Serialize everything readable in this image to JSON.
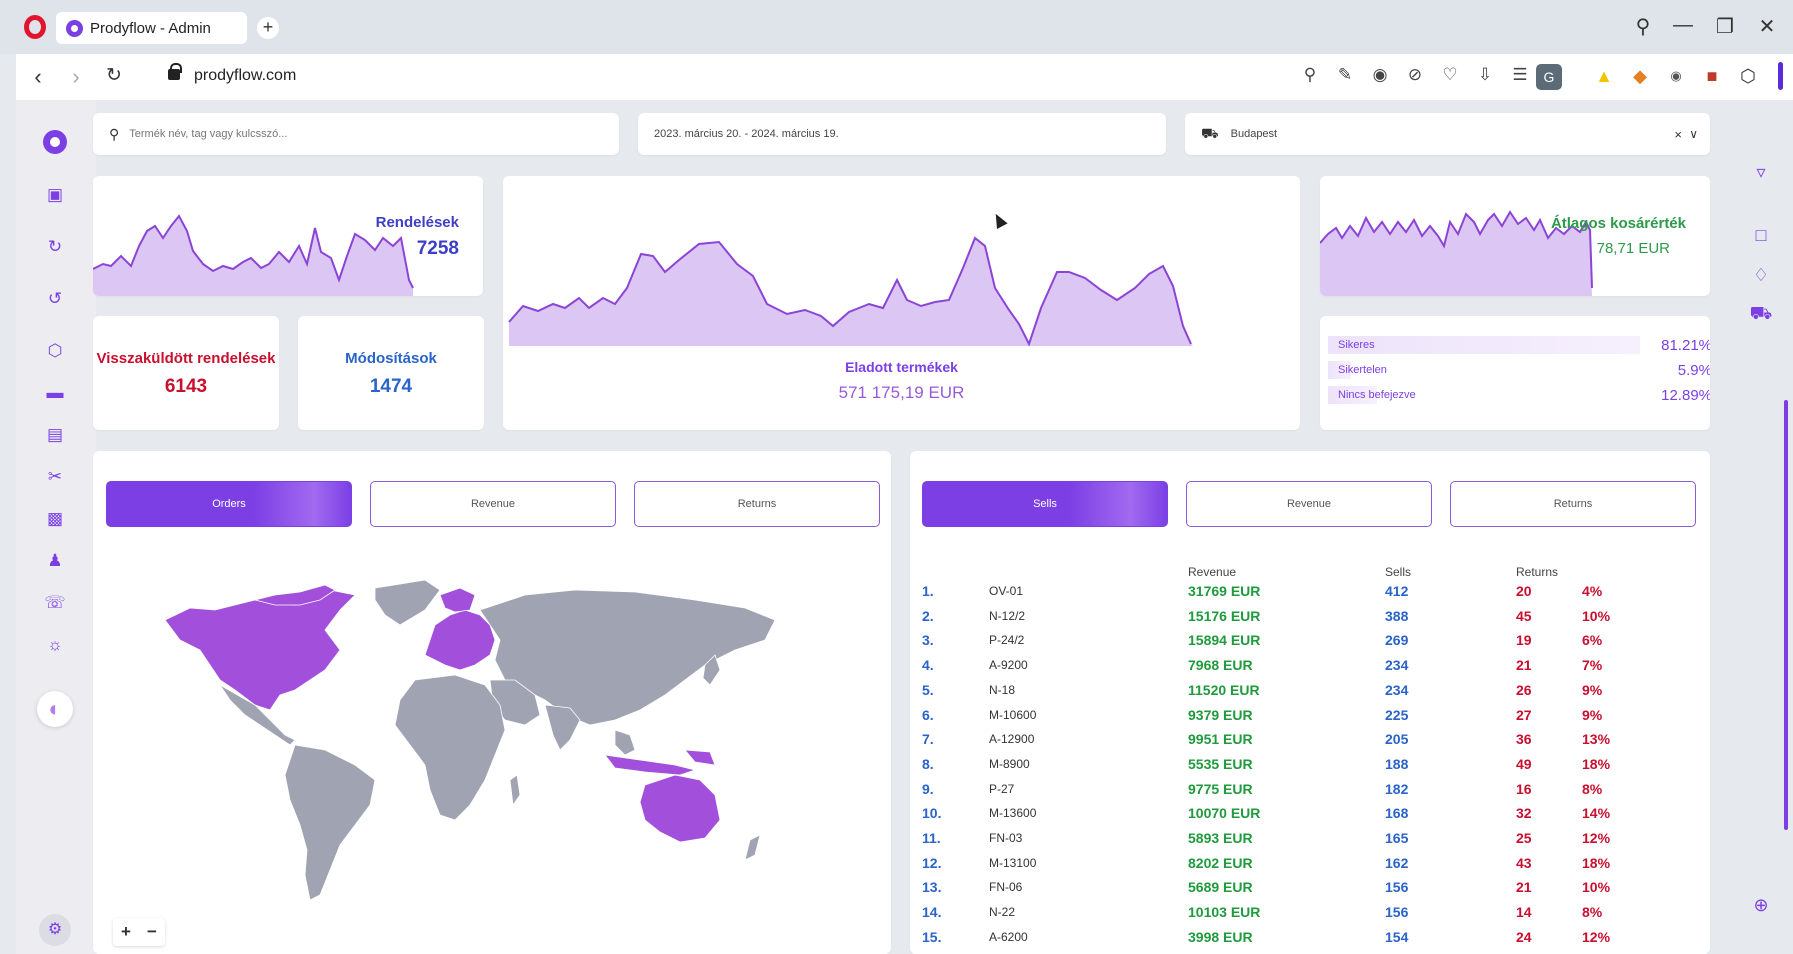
{
  "browser": {
    "tab_title": "Prodyflow - Admin",
    "url": "prodyflow.com",
    "avatar_letter": "G"
  },
  "filters": {
    "search_placeholder": "Termék név, tag vagy kulcsszó...",
    "date_range": "2023. március 20. - 2024. március 19.",
    "location": "Budapest"
  },
  "metrics": {
    "orders_label": "Rendelések",
    "orders_value": "7258",
    "returned_label": "Visszaküldött rendelések",
    "returned_value": "6143",
    "modifications_label": "Módosítások",
    "modifications_value": "1474",
    "sold_label": "Eladott termékek",
    "sold_value": "571 175,19 EUR",
    "avg_basket_label": "Átlagos kosárérték",
    "avg_basket_value": "78,71 EUR"
  },
  "status": [
    {
      "label": "Sikeres",
      "value": "81.21%",
      "fraction": 0.8121
    },
    {
      "label": "Sikertelen",
      "value": "5.9%",
      "fraction": 0.059
    },
    {
      "label": "Nincs befejezve",
      "value": "12.89%",
      "fraction": 0.1289
    }
  ],
  "map_tabs": [
    "Orders",
    "Revenue",
    "Returns"
  ],
  "table_tabs": [
    "Sells",
    "Revenue",
    "Returns"
  ],
  "table": {
    "headers": {
      "revenue": "Revenue",
      "sells": "Sells",
      "returns": "Returns"
    },
    "rows": [
      {
        "rank": "1.",
        "code": "OV-01",
        "revenue": "31769 EUR",
        "sells": "412",
        "returns": "20",
        "pct": "4%"
      },
      {
        "rank": "2.",
        "code": "N-12/2",
        "revenue": "15176 EUR",
        "sells": "388",
        "returns": "45",
        "pct": "10%"
      },
      {
        "rank": "3.",
        "code": "P-24/2",
        "revenue": "15894 EUR",
        "sells": "269",
        "returns": "19",
        "pct": "6%"
      },
      {
        "rank": "4.",
        "code": "A-9200",
        "revenue": "7968 EUR",
        "sells": "234",
        "returns": "21",
        "pct": "7%"
      },
      {
        "rank": "5.",
        "code": "N-18",
        "revenue": "11520 EUR",
        "sells": "234",
        "returns": "26",
        "pct": "9%"
      },
      {
        "rank": "6.",
        "code": "M-10600",
        "revenue": "9379 EUR",
        "sells": "225",
        "returns": "27",
        "pct": "9%"
      },
      {
        "rank": "7.",
        "code": "A-12900",
        "revenue": "9951 EUR",
        "sells": "205",
        "returns": "36",
        "pct": "13%"
      },
      {
        "rank": "8.",
        "code": "M-8900",
        "revenue": "5535 EUR",
        "sells": "188",
        "returns": "49",
        "pct": "18%"
      },
      {
        "rank": "9.",
        "code": "P-27",
        "revenue": "9775 EUR",
        "sells": "182",
        "returns": "16",
        "pct": "8%"
      },
      {
        "rank": "10.",
        "code": "M-13600",
        "revenue": "10070 EUR",
        "sells": "168",
        "returns": "32",
        "pct": "14%"
      },
      {
        "rank": "11.",
        "code": "FN-03",
        "revenue": "5893 EUR",
        "sells": "165",
        "returns": "25",
        "pct": "12%"
      },
      {
        "rank": "12.",
        "code": "M-13100",
        "revenue": "8202 EUR",
        "sells": "162",
        "returns": "43",
        "pct": "18%"
      },
      {
        "rank": "13.",
        "code": "FN-06",
        "revenue": "5689 EUR",
        "sells": "156",
        "returns": "21",
        "pct": "10%"
      },
      {
        "rank": "14.",
        "code": "N-22",
        "revenue": "10103 EUR",
        "sells": "156",
        "returns": "14",
        "pct": "8%"
      },
      {
        "rank": "15.",
        "code": "A-6200",
        "revenue": "3998 EUR",
        "sells": "154",
        "returns": "24",
        "pct": "12%"
      }
    ]
  },
  "map_controls": {
    "zoom_in": "+",
    "zoom_out": "−"
  },
  "colors": {
    "accent": "#7b3fe4",
    "revenue": "#1f9a3c",
    "sells": "#2a63c9",
    "returns": "#c8102e",
    "avg_basket": "#2e9a4a",
    "returned": "#c8102e"
  }
}
